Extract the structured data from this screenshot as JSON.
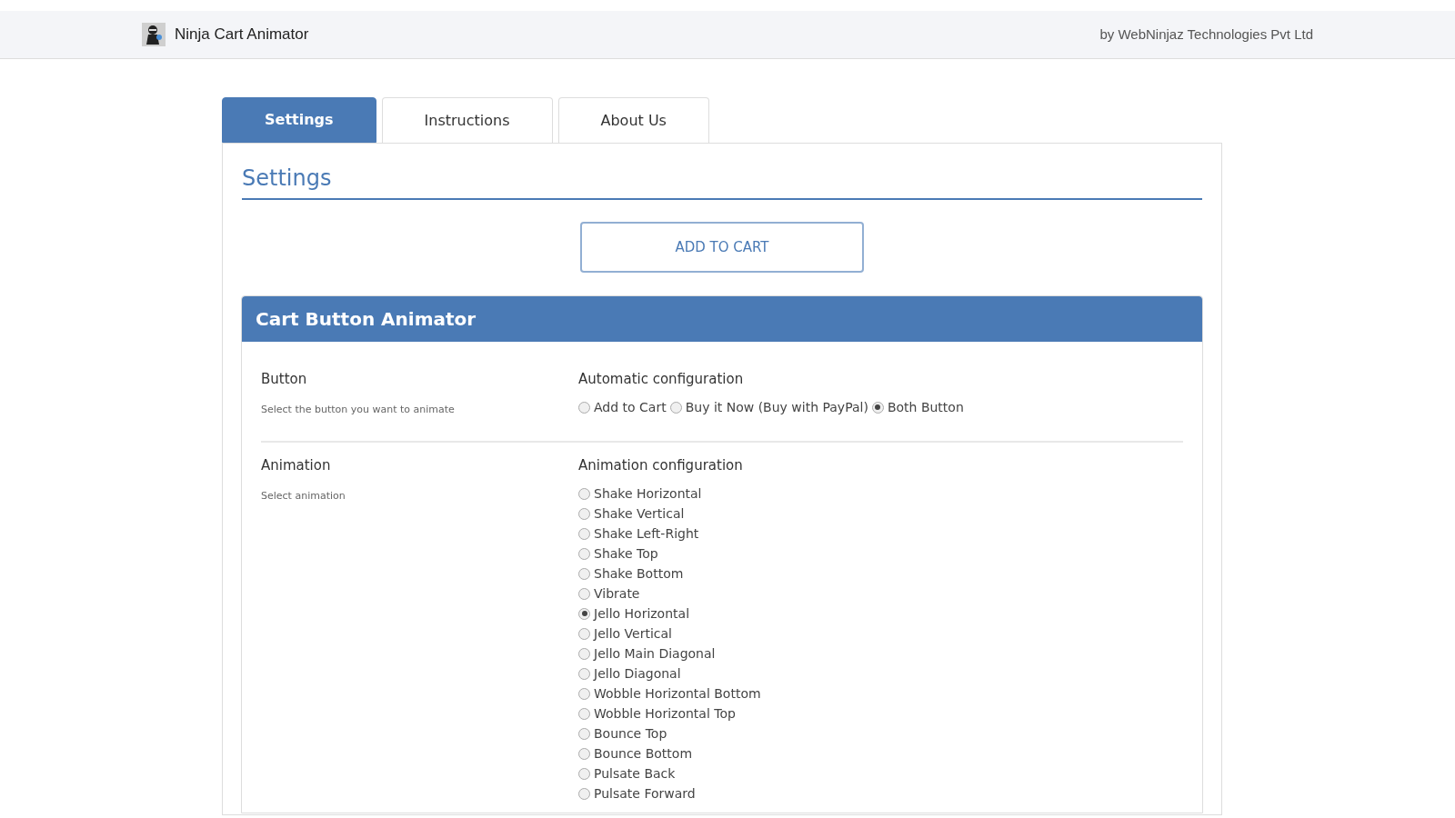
{
  "header": {
    "app_name": "Ninja Cart Animator",
    "byline": "by WebNinjaz Technologies Pvt Ltd"
  },
  "tabs": [
    {
      "label": "Settings",
      "selected": true
    },
    {
      "label": "Instructions",
      "selected": false
    },
    {
      "label": "About Us",
      "selected": false
    }
  ],
  "page_title": "Settings",
  "preview_button": "ADD TO CART",
  "panel": {
    "title": "Cart Button Animator",
    "sections": [
      {
        "label": "Button",
        "hint": "Select the button you want to animate",
        "config_title": "Automatic configuration",
        "kind": "inline",
        "options": [
          {
            "label": "Add to Cart",
            "selected": false
          },
          {
            "label": "Buy it Now (Buy with PayPal)",
            "selected": false
          },
          {
            "label": "Both Button",
            "selected": true
          }
        ]
      },
      {
        "label": "Animation",
        "hint": "Select animation",
        "config_title": "Animation configuration",
        "kind": "stacked",
        "options": [
          {
            "label": "Shake Horizontal",
            "selected": false
          },
          {
            "label": "Shake Vertical",
            "selected": false
          },
          {
            "label": "Shake Left-Right",
            "selected": false
          },
          {
            "label": "Shake Top",
            "selected": false
          },
          {
            "label": "Shake Bottom",
            "selected": false
          },
          {
            "label": "Vibrate",
            "selected": false
          },
          {
            "label": "Jello Horizontal",
            "selected": true
          },
          {
            "label": "Jello Vertical",
            "selected": false
          },
          {
            "label": "Jello Main Diagonal",
            "selected": false
          },
          {
            "label": "Jello Diagonal",
            "selected": false
          },
          {
            "label": "Wobble Horizontal Bottom",
            "selected": false
          },
          {
            "label": "Wobble Horizontal Top",
            "selected": false
          },
          {
            "label": "Bounce Top",
            "selected": false
          },
          {
            "label": "Bounce Bottom",
            "selected": false
          },
          {
            "label": "Pulsate Back",
            "selected": false
          },
          {
            "label": "Pulsate Forward",
            "selected": false
          }
        ]
      }
    ]
  }
}
